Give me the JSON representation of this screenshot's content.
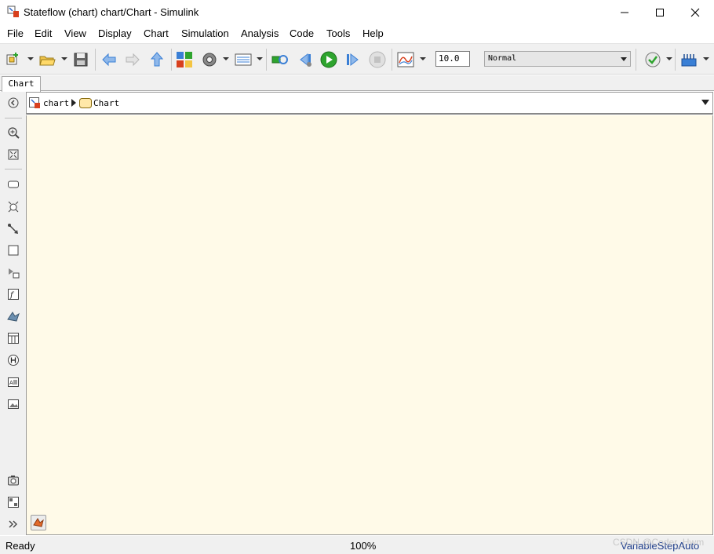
{
  "window": {
    "title": "Stateflow (chart) chart/Chart - Simulink"
  },
  "menu": [
    "File",
    "Edit",
    "View",
    "Display",
    "Chart",
    "Simulation",
    "Analysis",
    "Code",
    "Tools",
    "Help"
  ],
  "toolbar": {
    "stop_time": "10.0",
    "sim_mode": "Normal",
    "icons": [
      "new-model-icon",
      "open-folder-icon",
      "save-icon",
      "back-arrow-icon",
      "forward-arrow-icon",
      "up-arrow-icon",
      "library-browser-icon",
      "model-config-gear-icon",
      "model-explorer-icon",
      "update-diagram-icon",
      "step-back-icon",
      "run-icon",
      "step-forward-icon",
      "stop-icon",
      "data-inspector-icon",
      "model-advisor-icon",
      "build-icon"
    ]
  },
  "tabs": [
    "Chart"
  ],
  "breadcrumb": {
    "root": "chart",
    "current": "Chart"
  },
  "palette": [
    "hide-show-explorer-icon",
    "zoom-in-icon",
    "fit-view-icon",
    "state-tool-icon",
    "transition-junction-icon",
    "default-transition-icon",
    "box-tool-icon",
    "simulink-function-icon",
    "graphical-function-icon",
    "matlab-function-icon",
    "truth-table-icon",
    "history-junction-icon",
    "annotation-icon",
    "image-icon",
    "snapshot-icon",
    "viewmarks-icon",
    "expand-palette-icon"
  ],
  "status": {
    "state": "Ready",
    "zoom": "100%",
    "solver": "VariableStepAuto",
    "watermark": "CSDN @Coder_Hwm"
  },
  "colors": {
    "canvas": "#fffae8",
    "run_green": "#2ea42e",
    "blue_arrow": "#3a7fd5"
  }
}
